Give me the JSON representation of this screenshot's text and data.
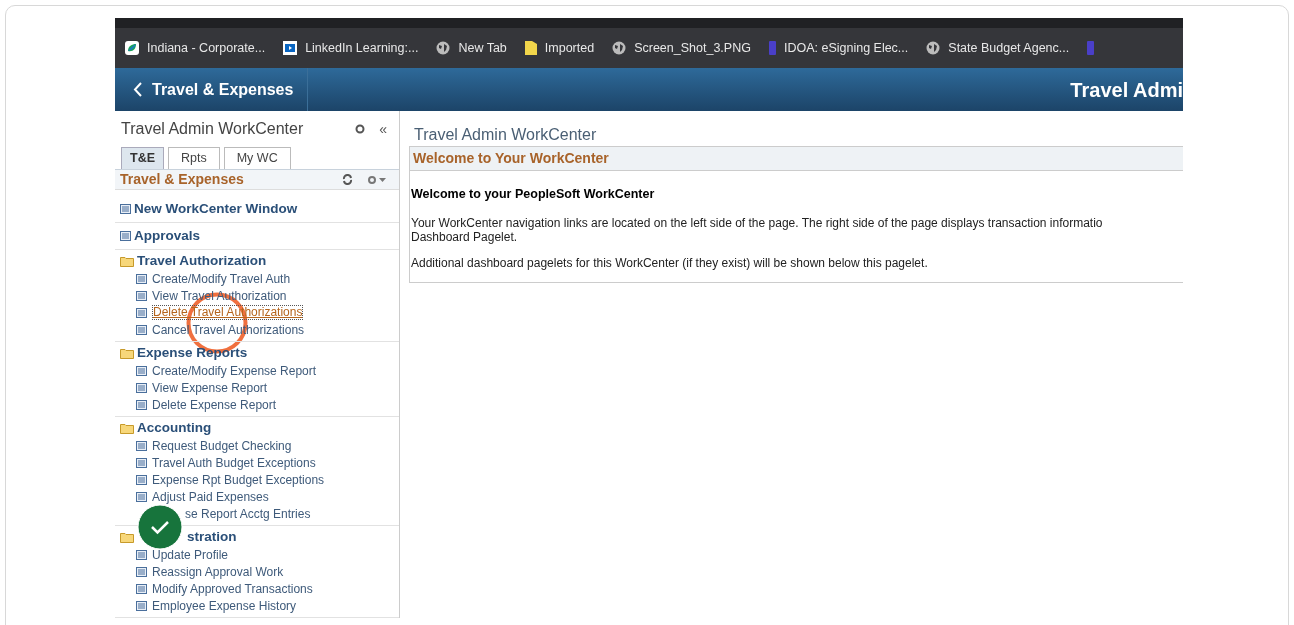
{
  "bookmarks": [
    {
      "kind": "leaf",
      "label": "Indiana - Corporate..."
    },
    {
      "kind": "video",
      "label": "LinkedIn Learning:..."
    },
    {
      "kind": "globe",
      "label": "New Tab"
    },
    {
      "kind": "folder",
      "label": "Imported"
    },
    {
      "kind": "globe",
      "label": "Screen_Shot_3.PNG"
    },
    {
      "kind": "doc",
      "label": "IDOA: eSigning Elec..."
    },
    {
      "kind": "globe",
      "label": "State Budget Agenc..."
    },
    {
      "kind": "doc"
    }
  ],
  "header": {
    "back_label": "Travel & Expenses",
    "title": "Travel Admi"
  },
  "sidebar": {
    "title": "Travel Admin WorkCenter",
    "collapse_label": "«",
    "tabs": [
      {
        "label": "T&E",
        "selected": true
      },
      {
        "label": "Rpts",
        "selected": false
      },
      {
        "label": "My WC",
        "selected": false
      }
    ],
    "section_title": "Travel & Expenses",
    "groups": [
      {
        "kind": "link",
        "label": "New WorkCenter Window"
      },
      {
        "kind": "link",
        "label": "Approvals"
      },
      {
        "kind": "folder",
        "label": "Travel Authorization",
        "covered": false,
        "children": [
          {
            "label": "Create/Modify Travel Auth",
            "hovered": false,
            "covered": false
          },
          {
            "label": "View Travel Authorization",
            "hovered": false,
            "covered": false
          },
          {
            "label": "Delete Travel Authorizations",
            "hovered": true,
            "covered": false
          },
          {
            "label": "Cancel Travel Authorizations",
            "hovered": false,
            "covered": false
          }
        ]
      },
      {
        "kind": "folder",
        "label": "Expense Reports",
        "covered": false,
        "children": [
          {
            "label": "Create/Modify Expense Report",
            "hovered": false,
            "covered": false
          },
          {
            "label": "View Expense Report",
            "hovered": false,
            "covered": false
          },
          {
            "label": "Delete Expense Report",
            "hovered": false,
            "covered": false
          }
        ]
      },
      {
        "kind": "folder",
        "label": "Accounting",
        "covered": false,
        "children": [
          {
            "label": "Request Budget Checking",
            "hovered": false,
            "covered": false
          },
          {
            "label": "Travel Auth Budget Exceptions",
            "hovered": false,
            "covered": false
          },
          {
            "label": "Expense Rpt Budget Exceptions",
            "hovered": false,
            "covered": false
          },
          {
            "label": "Adjust Paid Expenses",
            "hovered": false,
            "covered": false
          },
          {
            "label": "se Report Acctg Entries",
            "hovered": false,
            "covered": true
          }
        ]
      },
      {
        "kind": "folder",
        "label": "stration",
        "covered": true,
        "children": [
          {
            "label": "Update Profile",
            "hovered": false,
            "covered": false
          },
          {
            "label": "Reassign Approval Work",
            "hovered": false,
            "covered": false
          },
          {
            "label": "Modify Approved Transactions",
            "hovered": false,
            "covered": false
          },
          {
            "label": "Employee Expense History",
            "hovered": false,
            "covered": false
          }
        ]
      }
    ]
  },
  "main": {
    "title": "Travel Admin WorkCenter",
    "pagelet_title": "Welcome to Your WorkCenter",
    "heading": "Welcome to your PeopleSoft WorkCenter",
    "paragraphs": [
      "Your WorkCenter navigation links are located on the left side of the page. The right side of the page displays transaction informatio",
      "Dashboard Pagelet.",
      "Additional dashboard pagelets for this WorkCenter (if they exist) will be shown below this pagelet."
    ]
  }
}
